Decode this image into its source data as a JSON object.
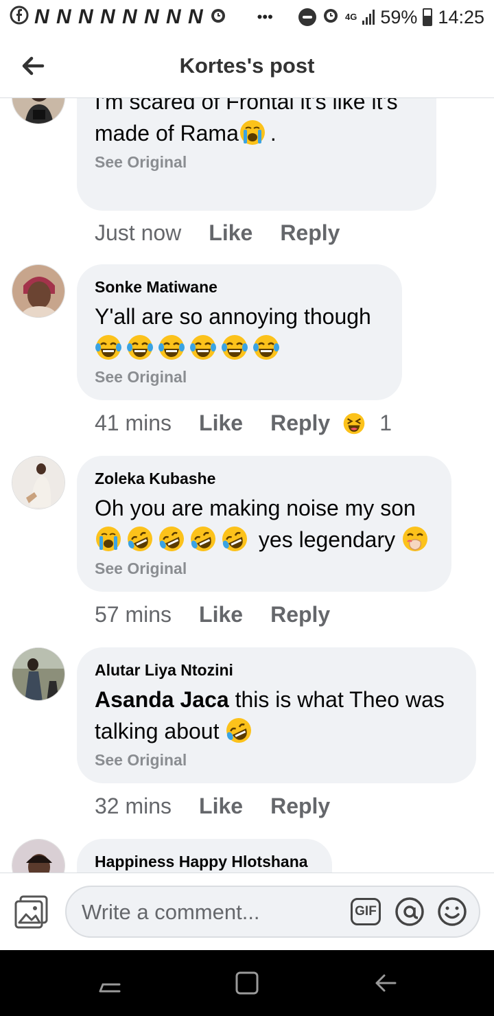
{
  "status_bar": {
    "left_notifications": "N N N N N N N N",
    "dots": "•••",
    "network": "4G",
    "battery": "59%",
    "time": "14:25"
  },
  "header": {
    "title": "Kortes's post"
  },
  "comments": [
    {
      "author": "",
      "text": "I'm scared of Frontal it's like it's made of Rama",
      "text_suffix": ".",
      "see_original": "See Original",
      "time": "Just now",
      "like": "Like",
      "reply": "Reply"
    },
    {
      "author": "Sonke Matiwane",
      "text": "Y'all are so annoying though",
      "see_original": "See Original",
      "time": "41 mins",
      "like": "Like",
      "reply": "Reply",
      "reaction_count": "1"
    },
    {
      "author": "Zoleka Kubashe",
      "text": "Oh you are making noise my son",
      "text_line2": "yes legendary",
      "see_original": "See Original",
      "time": "57 mins",
      "like": "Like",
      "reply": "Reply"
    },
    {
      "author": "Alutar Liya Ntozini",
      "mention": "Asanda Jaca",
      "text": " this is what Theo was talking about",
      "see_original": "See Original",
      "time": "32 mins",
      "like": "Like",
      "reply": "Reply"
    },
    {
      "author": "Happiness Happy Hlotshana"
    }
  ],
  "composer": {
    "placeholder": "Write a comment...",
    "gif_label": "GIF"
  },
  "icons": {
    "back": "arrow-left-icon",
    "photo": "photo-icon",
    "mention": "at-icon",
    "emoji": "smile-icon",
    "crying": "loudly-crying-face",
    "tears_joy": "face-with-tears-of-joy",
    "rofl": "rolling-on-floor-laughing",
    "laugh_react": "haha-reaction",
    "hand_over_mouth": "face-with-hand-over-mouth"
  },
  "colors": {
    "bubble": "#f0f2f5",
    "secondary_text": "#65676b",
    "see_original": "#8a8d91",
    "emoji_yellow": "#fcc21b",
    "tear_blue": "#3aa3e3"
  }
}
